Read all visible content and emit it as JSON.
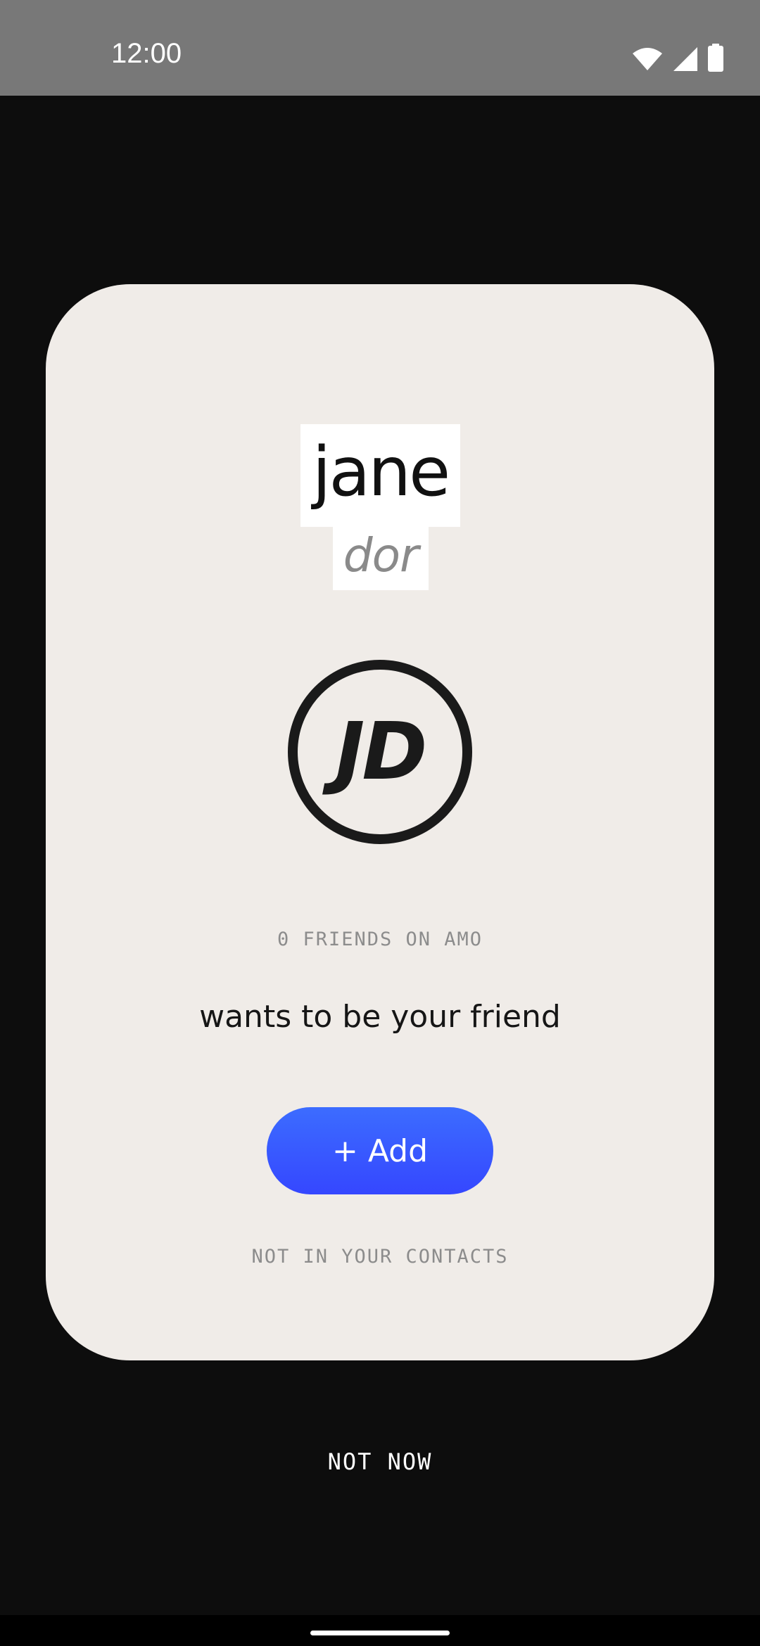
{
  "status_bar": {
    "time": "12:00",
    "icons": [
      "wifi-icon",
      "cellular-signal-icon",
      "battery-icon"
    ]
  },
  "profile": {
    "first_name": "jane",
    "last_name": "dor",
    "initials": "JD",
    "friends_count": "0 FRIENDS ON AMO"
  },
  "request": {
    "message": "wants to be your friend",
    "add_label": "+ Add",
    "contacts_note": "NOT IN YOUR CONTACTS"
  },
  "dismiss": {
    "label": "NOT NOW"
  },
  "colors": {
    "accent": "#3a5aff",
    "card": "#f0ece8",
    "background": "#0d0d0d",
    "status_bar": "#787878"
  }
}
